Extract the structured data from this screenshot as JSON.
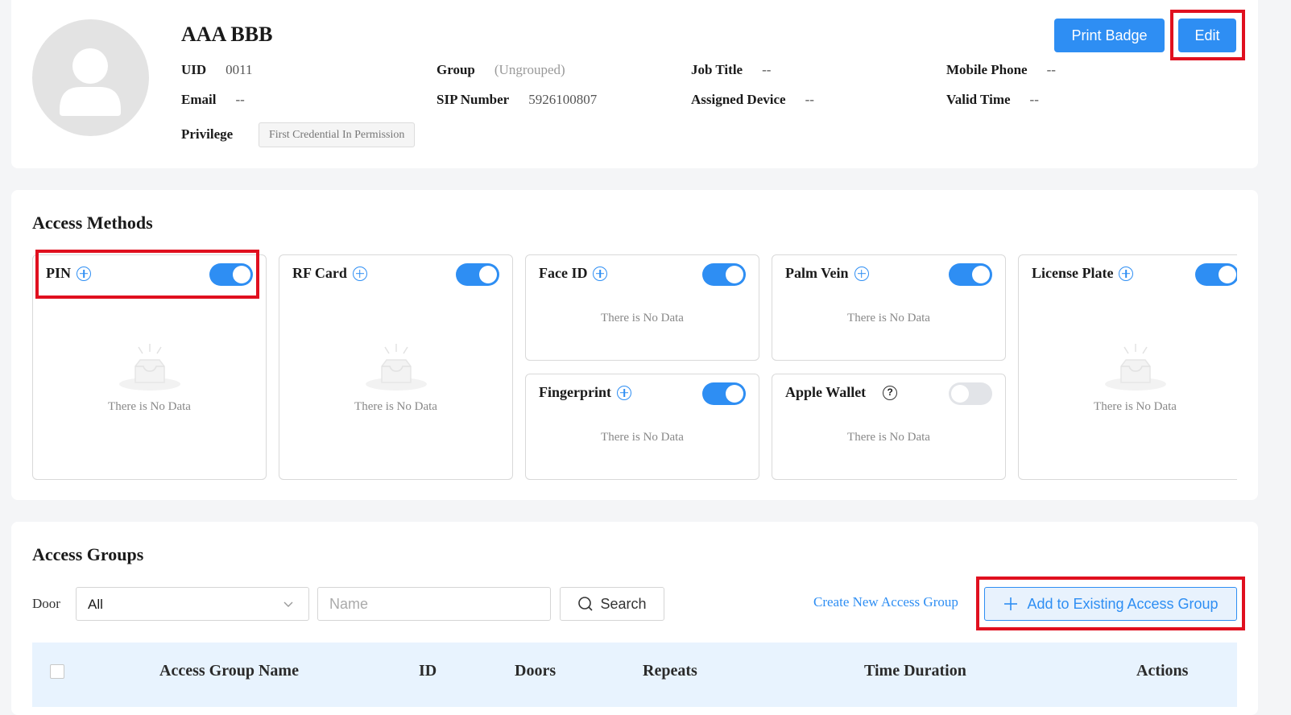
{
  "profile": {
    "name": "AAA BBB",
    "fields": {
      "uid": {
        "label": "UID",
        "value": "0011"
      },
      "group": {
        "label": "Group",
        "value": "(Ungrouped)"
      },
      "job_title": {
        "label": "Job Title",
        "value": "--"
      },
      "mobile_phone": {
        "label": "Mobile Phone",
        "value": "--"
      },
      "email": {
        "label": "Email",
        "value": "--"
      },
      "sip_number": {
        "label": "SIP Number",
        "value": "5926100807"
      },
      "assigned_device": {
        "label": "Assigned Device",
        "value": "--"
      },
      "valid_time": {
        "label": "Valid Time",
        "value": "--"
      }
    },
    "privilege": {
      "label": "Privilege",
      "value": "First Credential In Permission"
    },
    "buttons": {
      "print_badge": "Print Badge",
      "edit": "Edit"
    }
  },
  "access_methods": {
    "title": "Access Methods",
    "empty_text": "There is No Data",
    "items": [
      {
        "label": "PIN",
        "enabled": true,
        "icon": "plus-circle-icon"
      },
      {
        "label": "RF Card",
        "enabled": true,
        "icon": "plus-circle-icon"
      },
      {
        "label": "Face ID",
        "enabled": true,
        "icon": "plus-circle-icon"
      },
      {
        "label": "Palm Vein",
        "enabled": true,
        "icon": "plus-circle-icon"
      },
      {
        "label": "License Plate",
        "enabled": true,
        "icon": "plus-circle-icon"
      },
      {
        "label": "Fingerprint",
        "enabled": true,
        "icon": "plus-circle-icon"
      },
      {
        "label": "Apple Wallet",
        "enabled": false,
        "icon": "question-circle-icon"
      }
    ]
  },
  "access_groups": {
    "title": "Access Groups",
    "filters": {
      "door_label": "Door",
      "door_value": "All",
      "name_placeholder": "Name",
      "search_label": "Search"
    },
    "create_link": "Create New Access Group",
    "add_button": "Add to Existing Access Group",
    "columns": [
      "Access Group Name",
      "ID",
      "Doors",
      "Repeats",
      "Time Duration",
      "Actions"
    ]
  },
  "colors": {
    "accent": "#2e8ef3",
    "highlight": "#e0101f",
    "table_header_bg": "#e8f3fe"
  }
}
